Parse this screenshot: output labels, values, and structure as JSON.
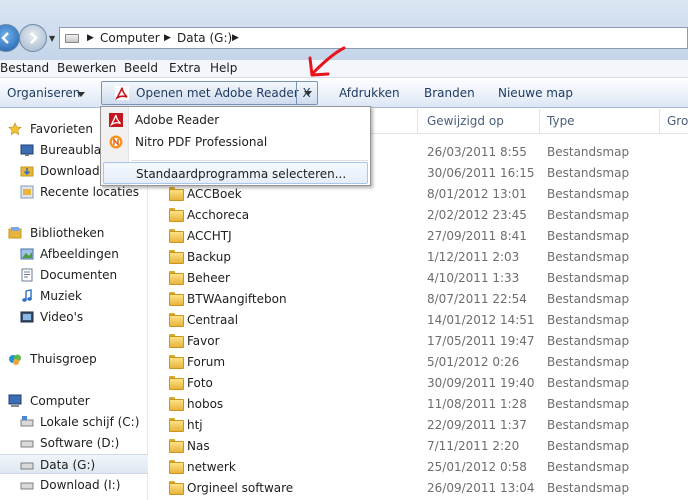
{
  "address": {
    "crumbs": [
      "Computer",
      "Data (G:)"
    ]
  },
  "menu": [
    "Bestand",
    "Bewerken",
    "Beeld",
    "Extra",
    "Help"
  ],
  "toolbar": {
    "organize": "Organiseren",
    "open_with": "Openen met Adobe Reader X",
    "print": "Afdrukken",
    "burn": "Branden",
    "new_folder": "Nieuwe map"
  },
  "dropdown": {
    "items": [
      "Adobe Reader",
      "Nitro PDF Professional",
      "Standaardprogramma selecteren..."
    ]
  },
  "nav": {
    "favorites": "Favorieten",
    "fav_items": [
      "Bureaublad",
      "Downloads",
      "Recente locaties"
    ],
    "libraries": "Bibliotheken",
    "lib_items": [
      "Afbeeldingen",
      "Documenten",
      "Muziek",
      "Video's"
    ],
    "homegroup": "Thuisgroep",
    "computer": "Computer",
    "drives": [
      "Lokale schijf (C:)",
      "Software (D:)",
      "Data (G:)",
      "Download (I:)"
    ]
  },
  "columns": {
    "modified": "Gewijzigd op",
    "type": "Type",
    "size": "Groo"
  },
  "files": [
    {
      "name": "",
      "date": "26/03/2011 8:55",
      "type": "Bestandsmap"
    },
    {
      "name": "",
      "date": "30/06/2011 16:15",
      "type": "Bestandsmap"
    },
    {
      "name": "ACCBoek",
      "date": "8/01/2012 13:01",
      "type": "Bestandsmap"
    },
    {
      "name": "Acchoreca",
      "date": "2/02/2012 23:45",
      "type": "Bestandsmap"
    },
    {
      "name": "ACCHTJ",
      "date": "27/09/2011 8:41",
      "type": "Bestandsmap"
    },
    {
      "name": "Backup",
      "date": "1/12/2011 2:03",
      "type": "Bestandsmap"
    },
    {
      "name": "Beheer",
      "date": "4/10/2011 1:33",
      "type": "Bestandsmap"
    },
    {
      "name": "BTWAangiftebon",
      "date": "8/07/2011 22:54",
      "type": "Bestandsmap"
    },
    {
      "name": "Centraal",
      "date": "14/01/2012 14:51",
      "type": "Bestandsmap"
    },
    {
      "name": "Favor",
      "date": "17/05/2011 19:47",
      "type": "Bestandsmap"
    },
    {
      "name": "Forum",
      "date": "5/01/2012 0:26",
      "type": "Bestandsmap"
    },
    {
      "name": "Foto",
      "date": "30/09/2011 19:40",
      "type": "Bestandsmap"
    },
    {
      "name": "hobos",
      "date": "11/08/2011 1:28",
      "type": "Bestandsmap"
    },
    {
      "name": "htj",
      "date": "22/09/2011 1:37",
      "type": "Bestandsmap"
    },
    {
      "name": "Nas",
      "date": "7/11/2011 2:20",
      "type": "Bestandsmap"
    },
    {
      "name": "netwerk",
      "date": "25/01/2012 0:58",
      "type": "Bestandsmap"
    },
    {
      "name": "Orgineel software",
      "date": "26/09/2011 13:04",
      "type": "Bestandsmap"
    }
  ],
  "colors": {
    "accent": "#1e3a5f",
    "folder": "#e8b43c",
    "pdf_red": "#c4161c",
    "annotation": "#e8141c"
  }
}
